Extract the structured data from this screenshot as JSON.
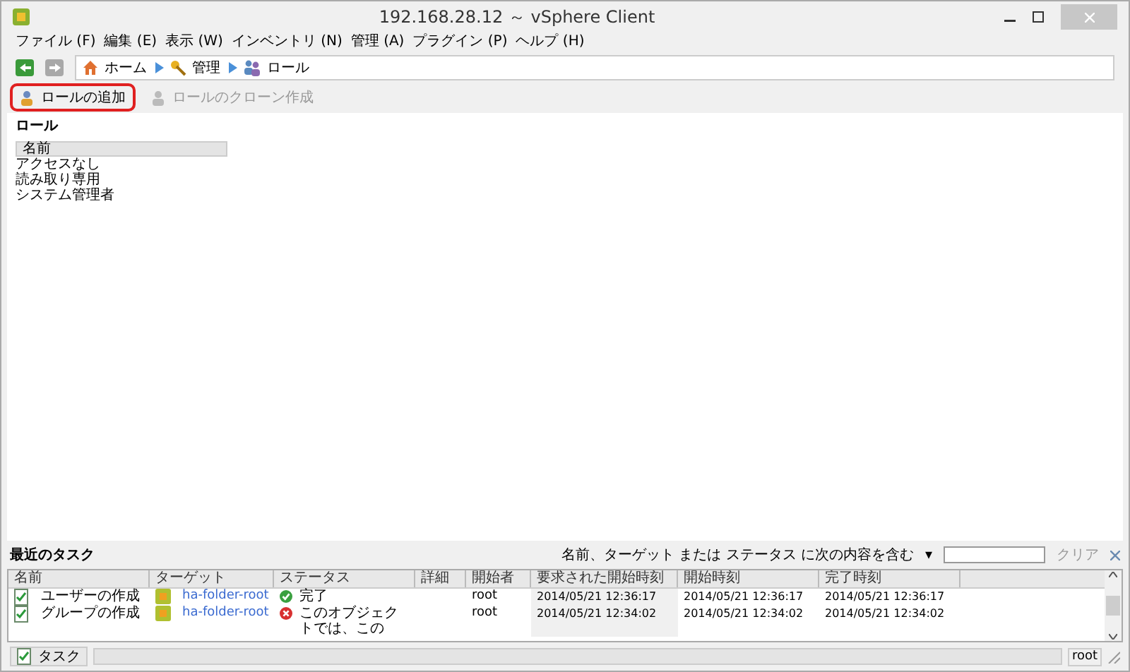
{
  "window": {
    "title": "192.168.28.12 ～ vSphere Client"
  },
  "menu": [
    "ファイル (F)",
    "編集 (E)",
    "表示 (W)",
    "インベントリ (N)",
    "管理 (A)",
    "プラグイン (P)",
    "ヘルプ (H)"
  ],
  "breadcrumb": [
    {
      "kind": "home",
      "label": "ホーム"
    },
    {
      "kind": "admin",
      "label": "管理"
    },
    {
      "kind": "roles",
      "label": "ロール"
    }
  ],
  "toolbar": [
    {
      "label": "ロールの追加",
      "disabled": false,
      "highlighted": true
    },
    {
      "label": "ロールのクローン作成",
      "disabled": true,
      "highlighted": false
    }
  ],
  "roles": {
    "title": "ロール",
    "column": "名前",
    "rows": [
      "アクセスなし",
      "読み取り専用",
      "システム管理者"
    ]
  },
  "tasks": {
    "title": "最近のタスク",
    "filter_dropdown": "▾",
    "filter_label": "名前、ターゲット または ステータス に次の内容を含む",
    "clear": "クリア",
    "columns": [
      "名前",
      "ターゲット",
      "ステータス",
      "詳細",
      "開始者",
      "要求された開始時刻",
      "開始時刻",
      "完了時刻"
    ],
    "rows": [
      {
        "name": "ユーザーの作成",
        "target": "ha-folder-root",
        "status": "完了",
        "kind": "ok",
        "initiator": "root",
        "requested": "2014/05/21 12:36:17",
        "started": "2014/05/21 12:36:17",
        "completed": "2014/05/21 12:36:17"
      },
      {
        "name": "グループの作成",
        "target": "ha-folder-root",
        "status": "このオブジェクトでは、この",
        "kind": "error",
        "initiator": "root",
        "requested": "2014/05/21 12:34:02",
        "started": "2014/05/21 12:34:02",
        "completed": "2014/05/21 12:34:02"
      }
    ]
  },
  "status_bar": {
    "tasks_button": "タスク",
    "user": "root"
  }
}
